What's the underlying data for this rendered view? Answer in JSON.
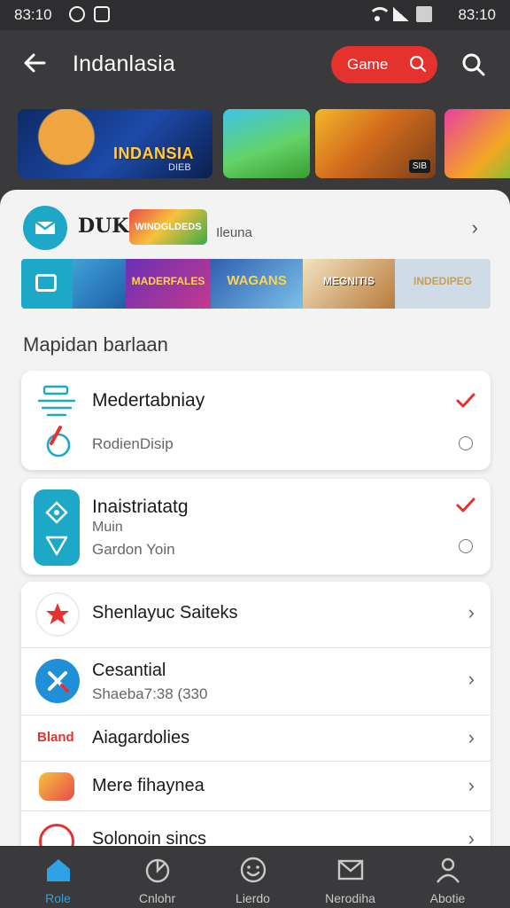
{
  "status_bar": {
    "time_left": "83:10",
    "time_right": "83:10"
  },
  "header": {
    "title": "Indanlasia",
    "search_pill_label": "Game"
  },
  "banners": [
    {
      "caption": "INDANSIA",
      "sub": "DIEB",
      "icon": "game-banner"
    },
    {
      "tag": "",
      "icon": "game-banner"
    },
    {
      "tag": "SIB",
      "icon": "game-banner"
    },
    {
      "tag": "",
      "icon": "game-banner"
    }
  ],
  "promo": {
    "logo_text": "DUK",
    "badge_text": "WINDGLDEDS",
    "label": "Ileuna",
    "strip_items": [
      "",
      "",
      "MADERFALES",
      "WAGANS",
      "MEGNITIS",
      "INDEDIPEG"
    ]
  },
  "section_title": "Mapidan barlaan",
  "card_one": {
    "primary": "Medertabniay",
    "secondary": "RodienDisip",
    "checked": true
  },
  "card_two": {
    "primary": "Inaistriatatg",
    "middle": "Muin",
    "secondary": "Gardon Yoin",
    "checked": true
  },
  "list": {
    "rows": [
      {
        "label": "Shenlayuc Saiteks"
      },
      {
        "label": "Cesantial",
        "sub": "Shaeba7:38 (330"
      },
      {
        "label": "Aiagardolies",
        "brand": "Bland"
      },
      {
        "label": "Mere fihaynea"
      },
      {
        "label": "Solonoin sincs"
      }
    ]
  },
  "bottom_nav": [
    {
      "label": "Role",
      "active": true,
      "icon": "home-icon"
    },
    {
      "label": "Cnlohr",
      "active": false,
      "icon": "chart-icon"
    },
    {
      "label": "Lierdo",
      "active": false,
      "icon": "smiley-icon"
    },
    {
      "label": "Nerodiha",
      "active": false,
      "icon": "mail-icon"
    },
    {
      "label": "Abotie",
      "active": false,
      "icon": "profile-icon"
    }
  ],
  "colors": {
    "accent_red": "#e5322f",
    "accent_teal": "#1ea8c8",
    "nav_active": "#2ea2e6"
  }
}
